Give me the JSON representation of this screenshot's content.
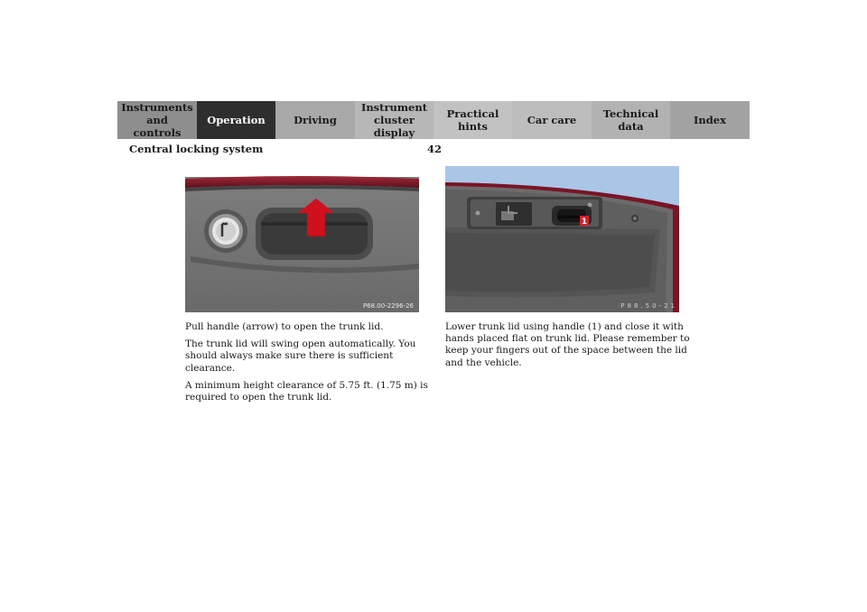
{
  "nav": {
    "tabs": [
      {
        "label": "Instruments\nand controls",
        "active": false
      },
      {
        "label": "Operation",
        "active": true
      },
      {
        "label": "Driving",
        "active": false
      },
      {
        "label": "Instrument\ncluster display",
        "active": false
      },
      {
        "label": "Practical hints",
        "active": false
      },
      {
        "label": "Car care",
        "active": false
      },
      {
        "label": "Technical\ndata",
        "active": false
      },
      {
        "label": "Index",
        "active": false
      }
    ]
  },
  "header": {
    "section_title": "Central locking system",
    "page_number": "42"
  },
  "figures": {
    "left_code": "P68.00-2296-26",
    "right_code": "P88.50-21",
    "right_callout": "1"
  },
  "text": {
    "left": [
      "Pull handle (arrow) to open the trunk lid.",
      "The trunk lid will swing open automatically. You should always make sure there is sufficient clearance.",
      "A minimum height clearance of 5.75 ft. (1.75 m) is required to open the trunk lid."
    ],
    "right": [
      "Lower trunk lid using handle (1) and close it with hands placed flat on trunk lid. Please remember to keep your fingers out of the space between the lid and the vehicle."
    ]
  },
  "colors": {
    "active_tab": "#2e2e2e",
    "car_paint": "#7a1426",
    "arrow": "#d0101c",
    "sky": "#a9c6e6"
  }
}
